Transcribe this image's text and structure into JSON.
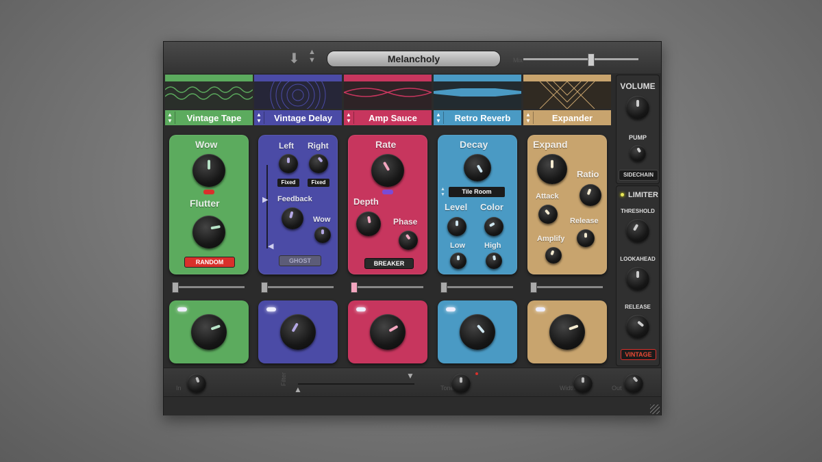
{
  "preset": {
    "name": "Melancholy"
  },
  "header": {
    "download_icon": "download-icon",
    "nav_icon": "up-down-arrows-icon",
    "mix_label": "Mix",
    "mix_value": 0.6
  },
  "modules": [
    {
      "name": "Vintage Tape",
      "color": "#5cab5e",
      "labels": {
        "wow": "Wow",
        "flutter": "Flutter"
      },
      "button": "RANDOM",
      "button_color": "#d9302b",
      "indicator_color": "#b8e3c8"
    },
    {
      "name": "Vintage Delay",
      "color": "#4b4ba6",
      "labels": {
        "left": "Left",
        "right": "Right",
        "left_mode": "Fixed",
        "right_mode": "Fixed",
        "feedback": "Feedback",
        "wow": "Wow"
      },
      "button": "GHOST",
      "button_color": "#5c5c78",
      "indicator_color": "#b4a8e4"
    },
    {
      "name": "Amp Sauce",
      "color": "#c7365e",
      "labels": {
        "rate": "Rate",
        "depth": "Depth",
        "phase": "Phase"
      },
      "button": "BREAKER",
      "button_color": "#2a2a2a",
      "indicator_color": "#f3a6bf"
    },
    {
      "name": "Retro Reverb",
      "color": "#4a9ac4",
      "labels": {
        "decay": "Decay",
        "room": "Tile Room",
        "level": "Level",
        "color": "Color",
        "low": "Low",
        "high": "High"
      },
      "indicator_color": "#cfe6f0"
    },
    {
      "name": "Expander",
      "color": "#c8a46e",
      "labels": {
        "expand": "Expand",
        "ratio": "Ratio",
        "attack": "Attack",
        "release": "Release",
        "amplify": "Amplify"
      },
      "indicator_color": "#f3ead0"
    }
  ],
  "sidebar": {
    "volume": "VOLUME",
    "pump": "PUMP",
    "sidechain": "SIDECHAIN",
    "limiter": "LIMITER",
    "threshold": "THRESHOLD",
    "lookahead": "LOOKAHEAD",
    "release": "RELEASE",
    "vintage": "VINTAGE"
  },
  "footer": {
    "labels": [
      "In",
      "Filter",
      "Tone",
      "Width",
      "Out"
    ]
  },
  "colors": {
    "accent_red": "#d9302b",
    "panel_bg": "#2b2b2b"
  }
}
